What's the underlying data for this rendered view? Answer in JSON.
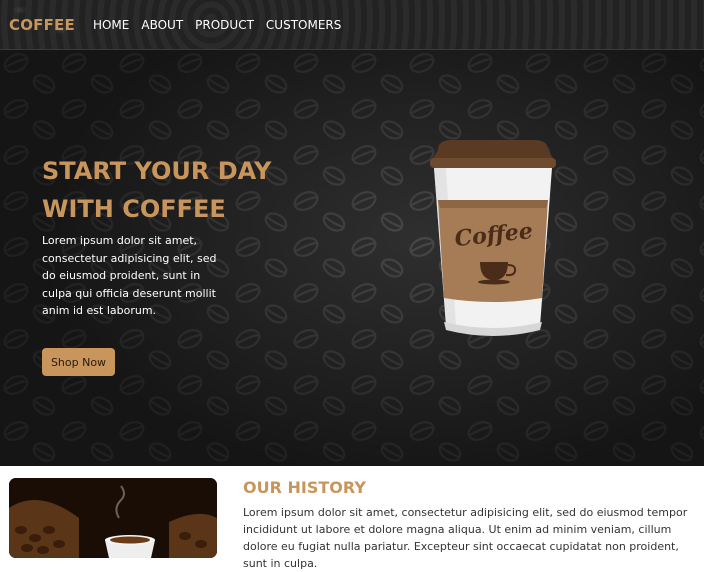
{
  "header": {
    "brand": "COFFEE",
    "nav": [
      "HOME",
      "ABOUT",
      "PRODUCT",
      "CUSTOMERS"
    ]
  },
  "hero": {
    "title_line1": "START YOUR DAY",
    "title_line2": "WITH COFFEE",
    "text": "Lorem ipsum dolor sit amet, consectetur adipisicing elit, sed do eiusmod proident, sunt in culpa qui officia deserunt mollit anim id est laborum.",
    "button": "Shop Now",
    "cup_label": "Coffee"
  },
  "about": {
    "title": "OUR HISTORY",
    "text": "Lorem ipsum dolor sit amet, consectetur adipisicing elit, sed do eiusmod tempor incididunt ut labore et dolore magna aliqua. Ut enim ad minim veniam, cillum dolore eu fugiat nulla pariatur. Excepteur sint occaecat cupidatat non proident, sunt in culpa."
  },
  "colors": {
    "accent": "#c8955c",
    "header_bg": "#262626",
    "hero_bg": "#2e2e2e"
  }
}
